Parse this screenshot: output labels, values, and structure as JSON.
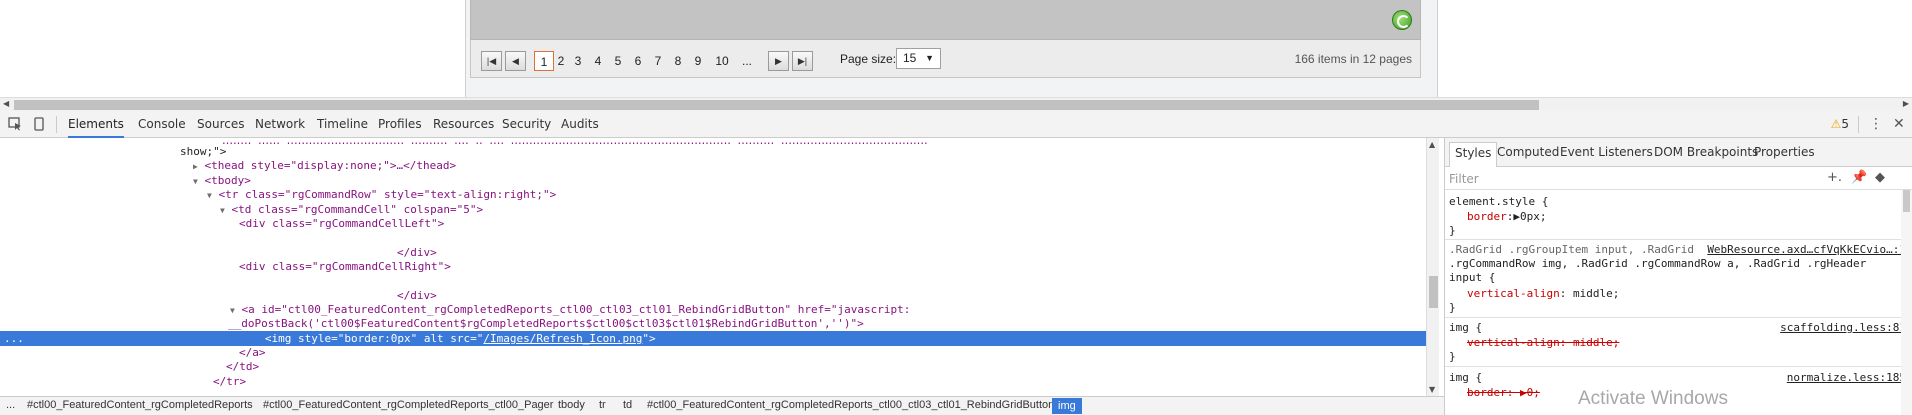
{
  "pager": {
    "pages": [
      "1",
      "2",
      "3",
      "4",
      "5",
      "6",
      "7",
      "8",
      "9",
      "10",
      "..."
    ],
    "current_page": "1",
    "page_size_label": "Page size:",
    "page_size_value": "15",
    "items_summary": "166 items in 12 pages"
  },
  "devtools": {
    "tabs": [
      "Elements",
      "Console",
      "Sources",
      "Network",
      "Timeline",
      "Profiles",
      "Resources",
      "Security",
      "Audits"
    ],
    "active_tab": "Elements",
    "warning_count": "5",
    "dom": {
      "l0": "show;\">",
      "l1_tag": "<thead style=\"display:none;\">…</thead>",
      "l2": "<tbody>",
      "l3_open": "<tr class=\"rgCommandRow\" style=\"text-align:right;\">",
      "l4_open": "<td class=\"rgCommandCell\" colspan=\"5\">",
      "l5": "<div class=\"rgCommandCellLeft\">",
      "l6": "</div>",
      "l7": "<div class=\"rgCommandCellRight\">",
      "l8": "</div>",
      "l9": "<a id=\"ctl00_FeaturedContent_rgCompletedReports_ctl00_ctl03_ctl01_RebindGridButton\" href=\"javascript:",
      "l10": "__doPostBack('ctl00$FeaturedContent$rgCompletedReports$ctl00$ctl03$ctl01$RebindGridButton','')\">",
      "l11_pre": "<img style=\"border:0px\" alt src=\"",
      "l11_link": "/Images/Refresh_Icon.png",
      "l11_post": "\">",
      "l12": "</a>",
      "l13": "</td>",
      "l14": "</tr>",
      "selected_marker": "..."
    },
    "styles": {
      "tabs": [
        "Styles",
        "Computed",
        "Event Listeners",
        "DOM Breakpoints",
        "Properties"
      ],
      "filter_placeholder": "Filter",
      "r1_selector": "element.style {",
      "r1_prop": "border",
      "r1_val": "0px;",
      "close": "}",
      "r2_selector_a": ".RadGrid .rgGroupItem input, .RadGrid",
      "r2_source": "WebResource.axd…cfVqKkECvio…:1",
      "r2_selector_b": ".rgCommandRow img, .RadGrid .rgCommandRow a, .RadGrid .rgHeader",
      "r2_selector_c": "input {",
      "r2_prop": "vertical-align",
      "r2_val": "middle;",
      "r3_selector": "img {",
      "r3_source": "scaffolding.less:81",
      "r3_struck": "vertical-align: middle;",
      "r4_selector": "img {",
      "r4_source": "normalize.less:185",
      "r4_struck": "border: ▶0;"
    },
    "breadcrumbs": [
      "...",
      "#ctl00_FeaturedContent_rgCompletedReports",
      "#ctl00_FeaturedContent_rgCompletedReports_ctl00_Pager",
      "tbody",
      "tr",
      "td",
      "#ctl00_FeaturedContent_rgCompletedReports_ctl00_ctl03_ctl01_RebindGridButton",
      "img"
    ]
  },
  "watermark": "Activate Windows"
}
